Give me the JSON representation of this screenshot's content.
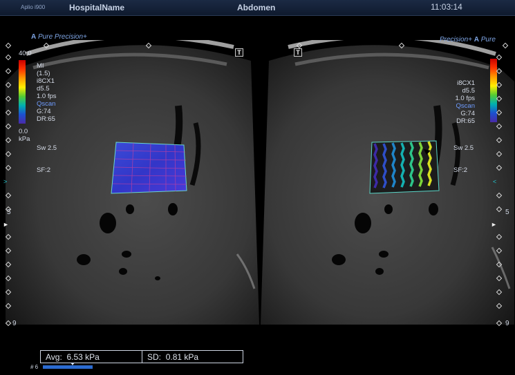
{
  "header": {
    "brand": "Aplio i900",
    "hospital": "HospitalName",
    "exam": "Abdomen",
    "time": "11:03:14"
  },
  "left_panel": {
    "badge_a": "A",
    "badge_pure": "Pure",
    "badge_precision": "Precision+",
    "t_button": "T",
    "scale_max": "40.0",
    "params": [
      "MI",
      "(1.5)",
      "i8CX1",
      "d5.5",
      "1.0 fps",
      "Qscan",
      "G:74",
      "DR:65"
    ],
    "scale_min": "0.0",
    "scale_unit": "kPa",
    "sweep": "Sw 2.5",
    "sf": "SF:2",
    "depth_5": "5",
    "depth_9": "9"
  },
  "right_panel": {
    "badge_precision": "Precision+",
    "badge_a": "A",
    "badge_pure": "Pure",
    "t_button": "T",
    "params": [
      "i8CX1",
      "d5.5",
      "1.0 fps",
      "Qscan",
      "G:74",
      "DR:65"
    ],
    "sweep": "Sw 2.5",
    "sf": "SF:2",
    "depth_5": "5",
    "depth_9": "9"
  },
  "measurement": {
    "avg_label": "Avg:",
    "avg_value": "6.53 kPa",
    "sd_label": "SD:",
    "sd_value": "0.81 kPa"
  },
  "frame": {
    "label": "# 6"
  },
  "colors": {
    "elastography_blue": "#3a3ad0",
    "wave_start": "#3a2aa8",
    "wave_end": "#ffee00",
    "accent_blue": "#6f9cff"
  }
}
